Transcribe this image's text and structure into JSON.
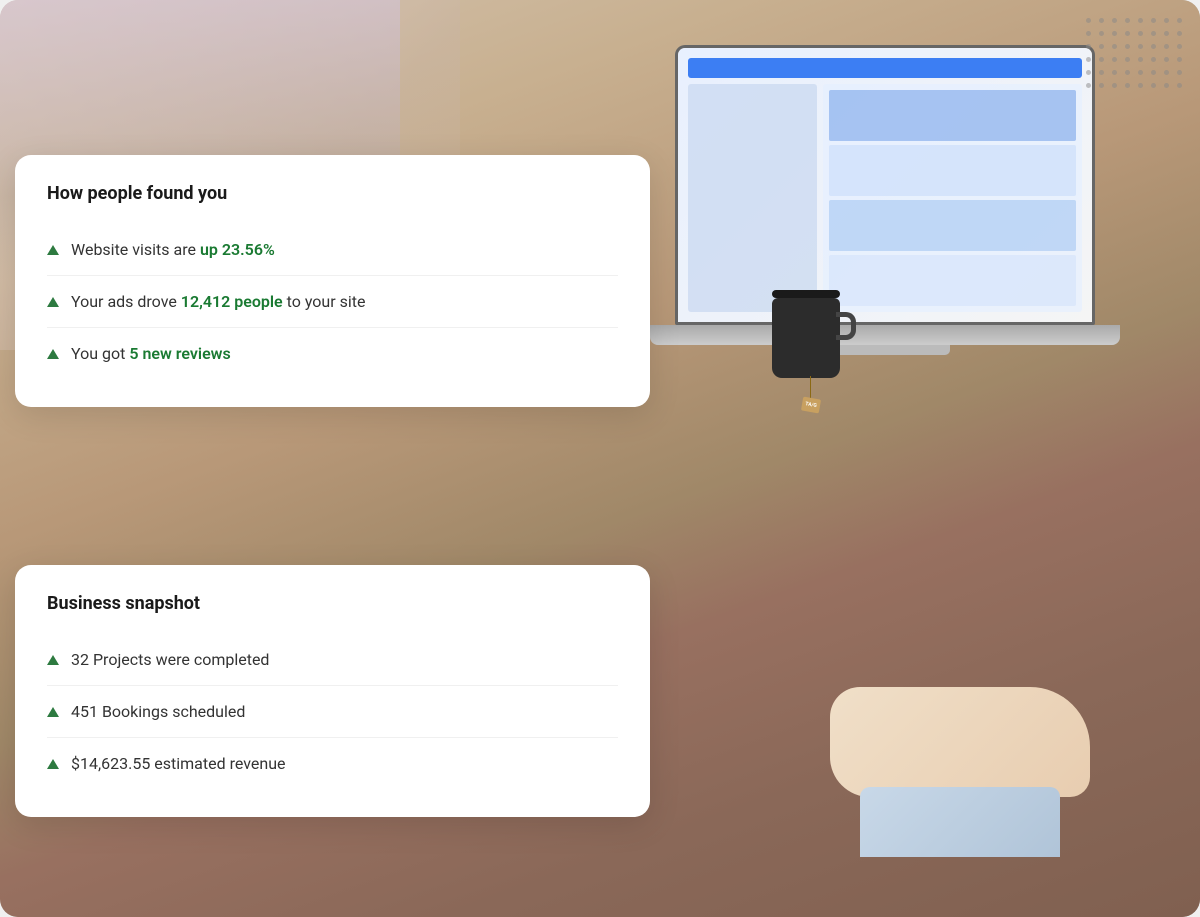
{
  "page": {
    "background_color": "#e8d5c0"
  },
  "dots": {
    "rows": 6,
    "cols": 8
  },
  "card_top": {
    "title": "How people found you",
    "items": [
      {
        "id": "website-visits",
        "text_before": "Website visits are ",
        "highlight": "up 23.56%",
        "text_after": ""
      },
      {
        "id": "ads-drove",
        "text_before": "Your ads drove ",
        "highlight": "12,412 people",
        "text_after": " to your site"
      },
      {
        "id": "reviews",
        "text_before": "You got ",
        "highlight": "5 new reviews",
        "text_after": ""
      }
    ]
  },
  "card_bottom": {
    "title": "Business snapshot",
    "items": [
      {
        "id": "projects",
        "text_before": "32 Projects were completed",
        "highlight": "",
        "text_after": ""
      },
      {
        "id": "bookings",
        "text_before": "451 Bookings scheduled",
        "highlight": "",
        "text_after": ""
      },
      {
        "id": "revenue",
        "text_before": "$14,623.55 estimated revenue",
        "highlight": "",
        "text_after": ""
      }
    ]
  }
}
